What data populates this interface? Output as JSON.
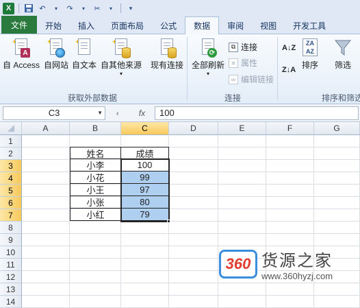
{
  "quick_access": {
    "undo_icon": "undo-icon",
    "redo_icon": "redo-icon"
  },
  "tabs": [
    {
      "label": "文件"
    },
    {
      "label": "开始"
    },
    {
      "label": "插入"
    },
    {
      "label": "页面布局"
    },
    {
      "label": "公式"
    },
    {
      "label": "数据"
    },
    {
      "label": "审阅"
    },
    {
      "label": "视图"
    },
    {
      "label": "开发工具"
    }
  ],
  "ribbon": {
    "external": {
      "access": "自 Access",
      "web": "自网站",
      "text": "自文本",
      "other": "自其他来源",
      "existing": "现有连接",
      "group": "获取外部数据"
    },
    "connections": {
      "refresh_all": "全部刷新",
      "connections": "连接",
      "properties": "属性",
      "edit_links": "编辑链接",
      "group": "连接"
    },
    "sort": {
      "sort": "排序",
      "filter": "筛选",
      "group": "排序和筛选"
    }
  },
  "formula_bar": {
    "name_box": "C3",
    "fx": "fx",
    "value": "100"
  },
  "columns": [
    "A",
    "B",
    "C",
    "D",
    "E",
    "F",
    "G"
  ],
  "rows": [
    "1",
    "2",
    "3",
    "4",
    "5",
    "6",
    "7",
    "8",
    "9",
    "10",
    "11",
    "12",
    "13",
    "14"
  ],
  "table": {
    "header": [
      "姓名",
      "成绩"
    ],
    "rows": [
      [
        "小李",
        "100"
      ],
      [
        "小花",
        "99"
      ],
      [
        "小王",
        "97"
      ],
      [
        "小张",
        "80"
      ],
      [
        "小红",
        "79"
      ]
    ]
  },
  "watermark": {
    "logo": "360",
    "title": "货源之家",
    "url": "www.360hyzj.com"
  }
}
